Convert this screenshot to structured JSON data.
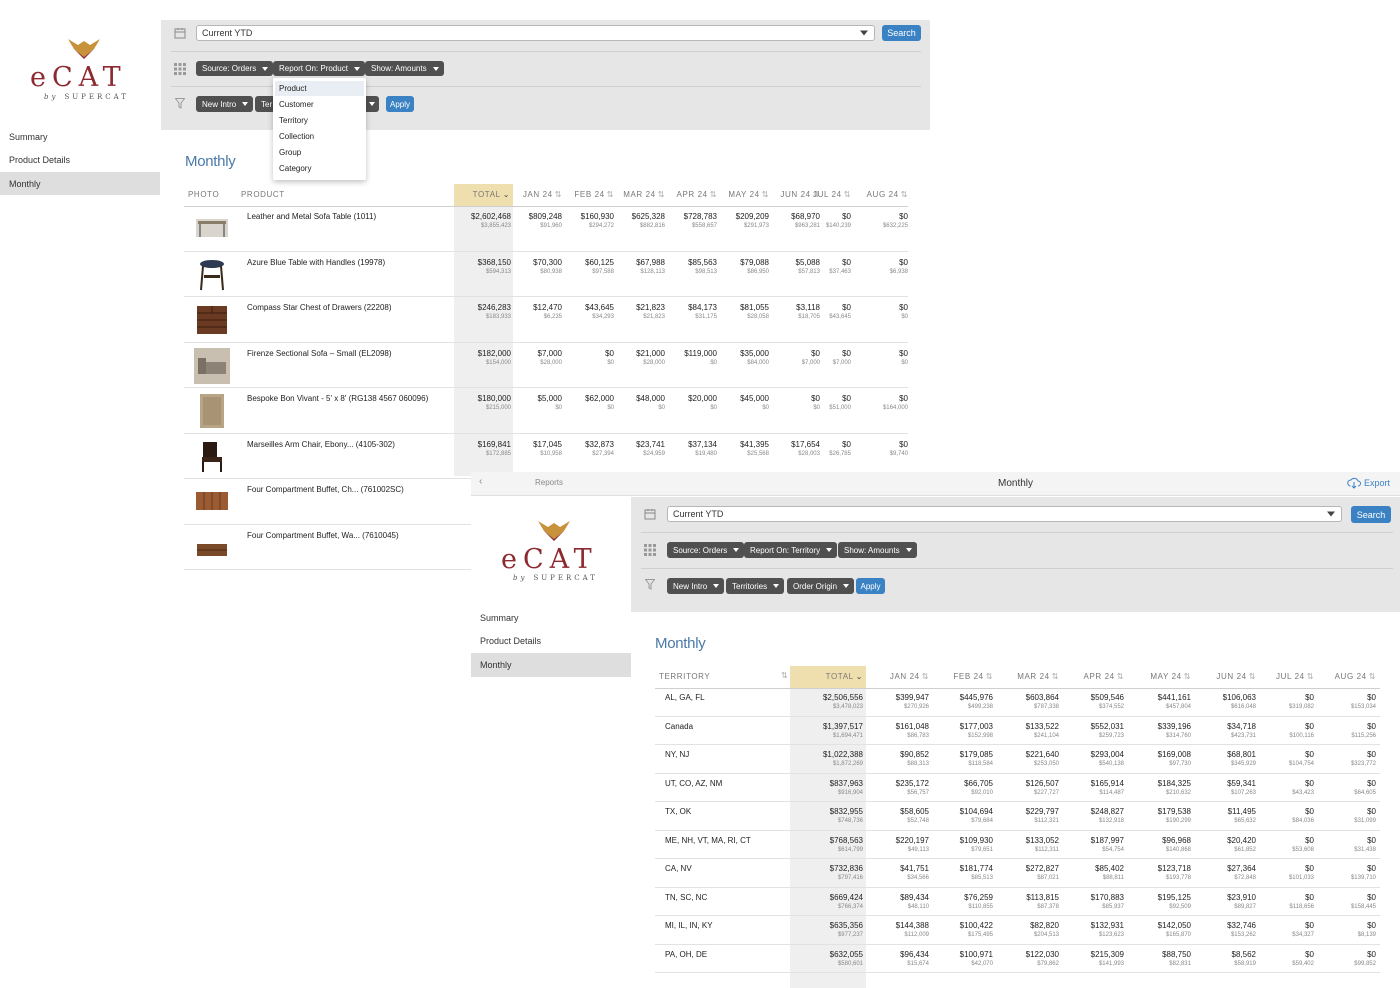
{
  "brand": {
    "word": "eCAT",
    "by": "by",
    "sub": "SUPERCAT",
    "color": "#8c2a2f"
  },
  "sidebar": {
    "items": [
      {
        "label": "Summary"
      },
      {
        "label": "Product Details"
      },
      {
        "label": "Monthly",
        "active": true
      }
    ]
  },
  "win1": {
    "date_range": "Current YTD",
    "search_label": "Search",
    "pills_row1": [
      "Source: Orders",
      "Report On: Product",
      "Show: Amounts"
    ],
    "pills_row2": [
      "New Intro",
      "Ter"
    ],
    "apply_label": "Apply",
    "dropdown": {
      "options": [
        "Product",
        "Customer",
        "Territory",
        "Collection",
        "Group",
        "Category"
      ],
      "selected": "Product"
    },
    "title": "Monthly",
    "headers": {
      "photo": "PHOTO",
      "product": "PRODUCT",
      "total": "TOTAL",
      "months": [
        "JAN 24",
        "FEB 24",
        "MAR 24",
        "APR 24",
        "MAY 24",
        "JUN 24",
        "JUL 24",
        "AUG 24"
      ]
    },
    "rows": [
      {
        "name": "Leather and Metal Sofa Table (1011)",
        "thumb": "table",
        "total": [
          "$2,602,468",
          "$3,855,423"
        ],
        "months": [
          [
            "$809,248",
            "$91,960"
          ],
          [
            "$160,930",
            "$294,272"
          ],
          [
            "$625,328",
            "$882,816"
          ],
          [
            "$728,783",
            "$558,657"
          ],
          [
            "$209,209",
            "$291,973"
          ],
          [
            "$68,970",
            "$963,281"
          ],
          [
            "$0",
            "$140,239"
          ],
          [
            "$0",
            "$632,225"
          ]
        ]
      },
      {
        "name": "Azure Blue Table with Handles (19978)",
        "thumb": "round-table",
        "total": [
          "$368,150",
          "$594,313"
        ],
        "months": [
          [
            "$70,300",
            "$80,938"
          ],
          [
            "$60,125",
            "$97,588"
          ],
          [
            "$67,988",
            "$128,113"
          ],
          [
            "$85,563",
            "$98,513"
          ],
          [
            "$79,088",
            "$86,950"
          ],
          [
            "$5,088",
            "$57,813"
          ],
          [
            "$0",
            "$37,463"
          ],
          [
            "$0",
            "$6,938"
          ]
        ]
      },
      {
        "name": "Compass Star Chest of Drawers (22208)",
        "thumb": "chest",
        "total": [
          "$246,283",
          "$183,933"
        ],
        "months": [
          [
            "$12,470",
            "$6,235"
          ],
          [
            "$43,645",
            "$34,293"
          ],
          [
            "$21,823",
            "$21,823"
          ],
          [
            "$84,173",
            "$31,175"
          ],
          [
            "$81,055",
            "$28,058"
          ],
          [
            "$3,118",
            "$18,705"
          ],
          [
            "$0",
            "$43,645"
          ],
          [
            "$0",
            "$0"
          ]
        ]
      },
      {
        "name": "Firenze Sectional Sofa – Small (EL2098)",
        "thumb": "sofa",
        "total": [
          "$182,000",
          "$154,000"
        ],
        "months": [
          [
            "$7,000",
            "$28,000"
          ],
          [
            "$0",
            "$0"
          ],
          [
            "$21,000",
            "$28,000"
          ],
          [
            "$119,000",
            "$0"
          ],
          [
            "$35,000",
            "$84,000"
          ],
          [
            "$0",
            "$7,000"
          ],
          [
            "$0",
            "$7,000"
          ],
          [
            "$0",
            "$0"
          ]
        ]
      },
      {
        "name": "Bespoke Bon Vivant - 5' x 8' (RG138 4567 060096)",
        "thumb": "rug",
        "total": [
          "$180,000",
          "$215,000"
        ],
        "months": [
          [
            "$5,000",
            "$0"
          ],
          [
            "$62,000",
            "$0"
          ],
          [
            "$48,000",
            "$0"
          ],
          [
            "$20,000",
            "$0"
          ],
          [
            "$45,000",
            "$0"
          ],
          [
            "$0",
            "$0"
          ],
          [
            "$0",
            "$51,000"
          ],
          [
            "$0",
            "$164,000"
          ]
        ]
      },
      {
        "name": "Marseilles Arm Chair, Ebony... (4105-302)",
        "thumb": "chair",
        "total": [
          "$169,841",
          "$172,885"
        ],
        "months": [
          [
            "$17,045",
            "$10,958"
          ],
          [
            "$32,873",
            "$27,394"
          ],
          [
            "$23,741",
            "$24,959"
          ],
          [
            "$37,134",
            "$19,480"
          ],
          [
            "$41,395",
            "$25,568"
          ],
          [
            "$17,654",
            "$28,003"
          ],
          [
            "$0",
            "$26,785"
          ],
          [
            "$0",
            "$9,740"
          ]
        ]
      },
      {
        "name": "Four Compartment Buffet, Ch... (761002SC)",
        "thumb": "buffet",
        "total": [],
        "months": []
      },
      {
        "name": "Four Compartment Buffet, Wa... (7610045)",
        "thumb": "buffet2",
        "total": [],
        "months": []
      }
    ]
  },
  "win2": {
    "header_title": "Monthly",
    "reports_label": "Reports",
    "export_label": "Export",
    "date_range": "Current YTD",
    "search_label": "Search",
    "pills_row1": [
      "Source: Orders",
      "Report On: Territory",
      "Show: Amounts"
    ],
    "pills_row2": [
      "New Intro",
      "Territories",
      "Order Origin"
    ],
    "apply_label": "Apply",
    "title": "Monthly",
    "headers": {
      "territory": "TERRITORY",
      "total": "TOTAL",
      "months": [
        "JAN 24",
        "FEB 24",
        "MAR 24",
        "APR 24",
        "MAY 24",
        "JUN 24",
        "JUL 24",
        "AUG 24"
      ]
    },
    "rows": [
      {
        "name": "AL, GA, FL",
        "total": [
          "$2,506,556",
          "$3,478,023"
        ],
        "months": [
          [
            "$399,947",
            "$270,926"
          ],
          [
            "$445,976",
            "$499,238"
          ],
          [
            "$603,864",
            "$787,338"
          ],
          [
            "$509,546",
            "$374,552"
          ],
          [
            "$441,161",
            "$457,804"
          ],
          [
            "$106,063",
            "$616,048"
          ],
          [
            "$0",
            "$319,082"
          ],
          [
            "$0",
            "$153,034"
          ]
        ]
      },
      {
        "name": "Canada",
        "total": [
          "$1,397,517",
          "$1,694,471"
        ],
        "months": [
          [
            "$161,048",
            "$86,783"
          ],
          [
            "$177,003",
            "$152,998"
          ],
          [
            "$133,522",
            "$241,104"
          ],
          [
            "$552,031",
            "$259,723"
          ],
          [
            "$339,196",
            "$314,760"
          ],
          [
            "$34,718",
            "$423,731"
          ],
          [
            "$0",
            "$100,116"
          ],
          [
            "$0",
            "$115,256"
          ]
        ]
      },
      {
        "name": "NY, NJ",
        "total": [
          "$1,022,388",
          "$1,872,269"
        ],
        "months": [
          [
            "$90,852",
            "$88,313"
          ],
          [
            "$179,085",
            "$118,584"
          ],
          [
            "$221,640",
            "$253,050"
          ],
          [
            "$293,004",
            "$540,138"
          ],
          [
            "$169,008",
            "$97,730"
          ],
          [
            "$68,801",
            "$345,929"
          ],
          [
            "$0",
            "$104,754"
          ],
          [
            "$0",
            "$323,772"
          ]
        ]
      },
      {
        "name": "UT, CO, AZ, NM",
        "total": [
          "$837,963",
          "$916,904"
        ],
        "months": [
          [
            "$235,172",
            "$56,757"
          ],
          [
            "$66,705",
            "$92,010"
          ],
          [
            "$126,507",
            "$227,727"
          ],
          [
            "$165,914",
            "$114,487"
          ],
          [
            "$184,325",
            "$210,632"
          ],
          [
            "$59,341",
            "$107,263"
          ],
          [
            "$0",
            "$43,423"
          ],
          [
            "$0",
            "$64,605"
          ]
        ]
      },
      {
        "name": "TX, OK",
        "total": [
          "$832,955",
          "$748,736"
        ],
        "months": [
          [
            "$58,605",
            "$52,748"
          ],
          [
            "$104,694",
            "$79,684"
          ],
          [
            "$229,797",
            "$112,321"
          ],
          [
            "$248,827",
            "$132,918"
          ],
          [
            "$179,538",
            "$190,299"
          ],
          [
            "$11,495",
            "$65,632"
          ],
          [
            "$0",
            "$84,036"
          ],
          [
            "$0",
            "$31,099"
          ]
        ]
      },
      {
        "name": "ME, NH, VT, MA, RI, CT",
        "total": [
          "$768,563",
          "$614,799"
        ],
        "months": [
          [
            "$220,197",
            "$49,113"
          ],
          [
            "$109,930",
            "$79,651"
          ],
          [
            "$133,052",
            "$112,311"
          ],
          [
            "$187,997",
            "$54,754"
          ],
          [
            "$96,968",
            "$140,868"
          ],
          [
            "$20,420",
            "$61,852"
          ],
          [
            "$0",
            "$53,608"
          ],
          [
            "$0",
            "$31,438"
          ]
        ]
      },
      {
        "name": "CA, NV",
        "total": [
          "$732,836",
          "$797,416"
        ],
        "months": [
          [
            "$41,751",
            "$34,566"
          ],
          [
            "$181,774",
            "$85,513"
          ],
          [
            "$272,827",
            "$87,021"
          ],
          [
            "$85,402",
            "$88,811"
          ],
          [
            "$123,718",
            "$193,778"
          ],
          [
            "$27,364",
            "$72,848"
          ],
          [
            "$0",
            "$101,033"
          ],
          [
            "$0",
            "$139,710"
          ]
        ]
      },
      {
        "name": "TN, SC, NC",
        "total": [
          "$669,424",
          "$766,374"
        ],
        "months": [
          [
            "$89,434",
            "$48,110"
          ],
          [
            "$76,259",
            "$110,855"
          ],
          [
            "$113,815",
            "$87,378"
          ],
          [
            "$170,883",
            "$85,937"
          ],
          [
            "$195,125",
            "$92,509"
          ],
          [
            "$23,910",
            "$89,827"
          ],
          [
            "$0",
            "$118,656"
          ],
          [
            "$0",
            "$158,445"
          ]
        ]
      },
      {
        "name": "MI, IL, IN, KY",
        "total": [
          "$635,356",
          "$977,237"
        ],
        "months": [
          [
            "$144,388",
            "$112,009"
          ],
          [
            "$100,422",
            "$175,495"
          ],
          [
            "$82,820",
            "$204,513"
          ],
          [
            "$132,931",
            "$123,623"
          ],
          [
            "$142,050",
            "$165,870"
          ],
          [
            "$32,746",
            "$153,262"
          ],
          [
            "$0",
            "$34,327"
          ],
          [
            "$0",
            "$8,139"
          ]
        ]
      },
      {
        "name": "PA, OH, DE",
        "total": [
          "$632,055",
          "$580,601"
        ],
        "months": [
          [
            "$96,434",
            "$15,674"
          ],
          [
            "$100,971",
            "$42,070"
          ],
          [
            "$122,030",
            "$79,862"
          ],
          [
            "$215,309",
            "$141,993"
          ],
          [
            "$88,750",
            "$82,831"
          ],
          [
            "$8,562",
            "$58,919"
          ],
          [
            "$0",
            "$59,402"
          ],
          [
            "$0",
            "$99,852"
          ]
        ]
      }
    ]
  }
}
